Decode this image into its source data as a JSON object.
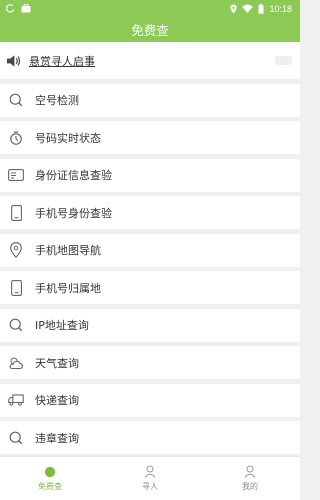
{
  "status_bar": {
    "time": "10:18"
  },
  "title": "免费查",
  "notice": {
    "text": "悬赏寻人启事"
  },
  "items": [
    {
      "label": "空号检测",
      "icon": "search-icon"
    },
    {
      "label": "号码实时状态",
      "icon": "stopwatch-icon"
    },
    {
      "label": "身份证信息查验",
      "icon": "id-card-icon"
    },
    {
      "label": "手机号身份查验",
      "icon": "phone-icon"
    },
    {
      "label": "手机地图导航",
      "icon": "map-pin-icon"
    },
    {
      "label": "手机号归属地",
      "icon": "phone-icon"
    },
    {
      "label": "IP地址查询",
      "icon": "search-icon"
    },
    {
      "label": "天气查询",
      "icon": "weather-icon"
    },
    {
      "label": "快递查询",
      "icon": "truck-icon"
    },
    {
      "label": "违章查询",
      "icon": "search-icon"
    }
  ],
  "bottom_nav": [
    {
      "label": "免费查",
      "active": true
    },
    {
      "label": "寻人",
      "active": false
    },
    {
      "label": "我的",
      "active": false
    }
  ],
  "colors": {
    "accent": "#8dc955",
    "active_tab": "#7dbb45",
    "background": "#f0f0f0"
  }
}
